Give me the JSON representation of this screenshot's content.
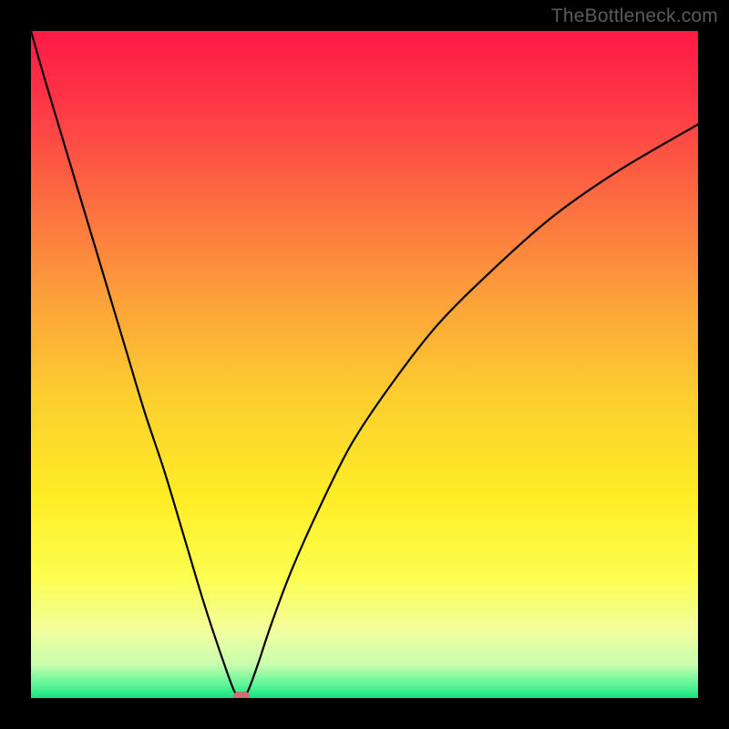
{
  "watermark": "TheBottleneck.com",
  "chart_data": {
    "type": "line",
    "title": "",
    "xlabel": "",
    "ylabel": "",
    "xlim": [
      0,
      100
    ],
    "ylim": [
      0,
      100
    ],
    "grid": false,
    "legend": false,
    "series": [
      {
        "name": "bottleneck-curve",
        "x": [
          0,
          2,
          5,
          8,
          11,
          14,
          17,
          20,
          23,
          26,
          29,
          30.5,
          31.5,
          32.5,
          34,
          36,
          39,
          43,
          48,
          54,
          61,
          69,
          78,
          88,
          100
        ],
        "y": [
          100,
          93,
          83,
          73,
          63,
          53,
          43,
          34,
          24,
          14,
          5,
          1,
          0,
          1,
          5,
          11,
          19,
          28,
          38,
          47,
          56,
          64,
          72,
          79,
          86
        ],
        "color": "#000000",
        "linewidth": 2.2
      }
    ],
    "marker": {
      "name": "optimal-point",
      "x": 31.5,
      "y": 0,
      "color": "#cb6f72"
    },
    "background_gradient": {
      "type": "vertical",
      "stops": [
        {
          "pos": 0.0,
          "color": "#fe1a46"
        },
        {
          "pos": 0.1,
          "color": "#fe3447"
        },
        {
          "pos": 0.25,
          "color": "#fc6b41"
        },
        {
          "pos": 0.4,
          "color": "#fca03a"
        },
        {
          "pos": 0.55,
          "color": "#fccf2f"
        },
        {
          "pos": 0.7,
          "color": "#feed26"
        },
        {
          "pos": 0.82,
          "color": "#fcfe50"
        },
        {
          "pos": 0.9,
          "color": "#f2fea0"
        },
        {
          "pos": 0.95,
          "color": "#c8feae"
        },
        {
          "pos": 0.98,
          "color": "#5cf698"
        },
        {
          "pos": 1.0,
          "color": "#14e27c"
        }
      ]
    }
  }
}
